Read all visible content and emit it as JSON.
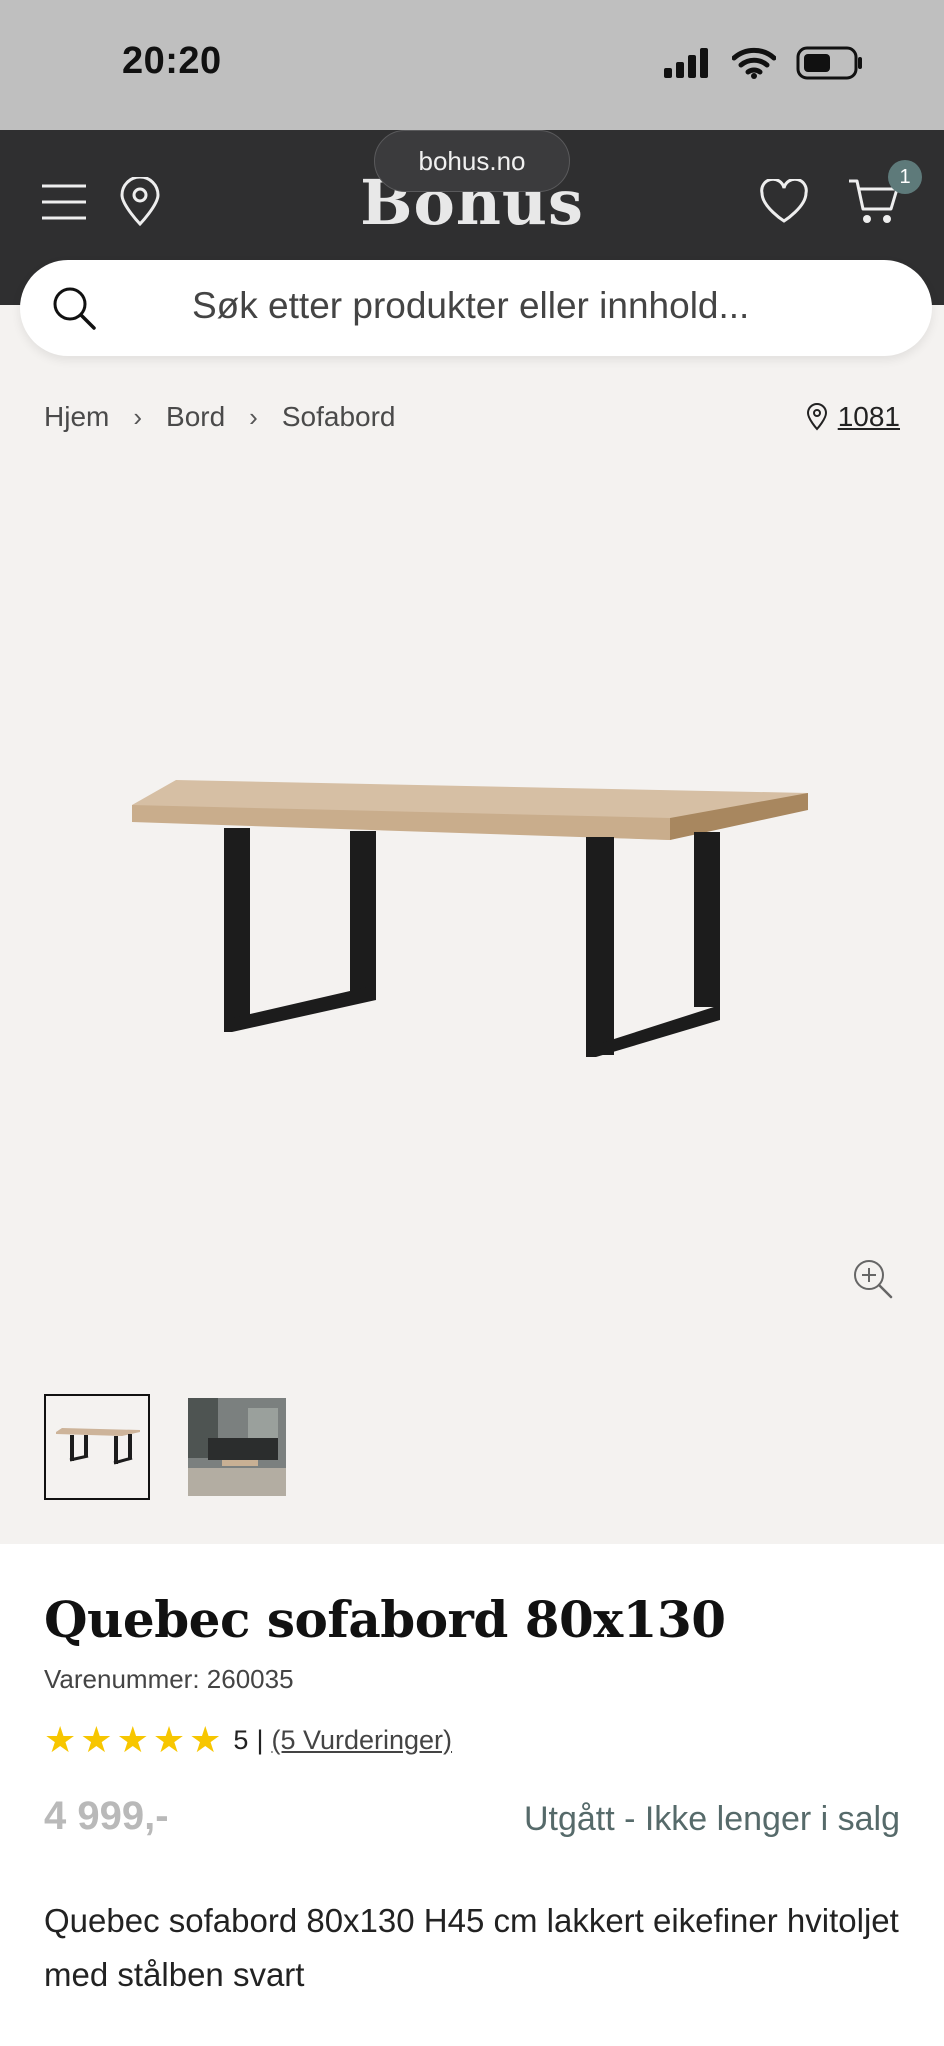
{
  "status_bar": {
    "time": "20:20"
  },
  "header": {
    "logo": "Bohus",
    "url": "bohus.no",
    "cart_count": "1"
  },
  "search": {
    "placeholder": "Søk etter produkter eller innhold..."
  },
  "breadcrumb": {
    "items": [
      "Hjem",
      "Bord",
      "Sofabord"
    ],
    "store": "1081"
  },
  "product": {
    "title": "Quebec sofabord 80x130",
    "sku": "Varenummer: 260035",
    "rating_value": "5",
    "rating_sep": "|",
    "rating_count": "(5 Vurderinger)",
    "stars": 5,
    "price": "4 999,-",
    "availability": "Utgått - Ikke lenger i salg",
    "description": "Quebec sofabord 80x130 H45 cm lakkert eikefiner hvitoljet med stålben svart"
  },
  "colors": {
    "header_bg": "#2f2f30",
    "status_bar_bg": "#bfbfbf",
    "page_bg": "#f4f2f0",
    "star": "#f7c600",
    "availability": "#566a6a",
    "badge": "#5e7a7a"
  }
}
